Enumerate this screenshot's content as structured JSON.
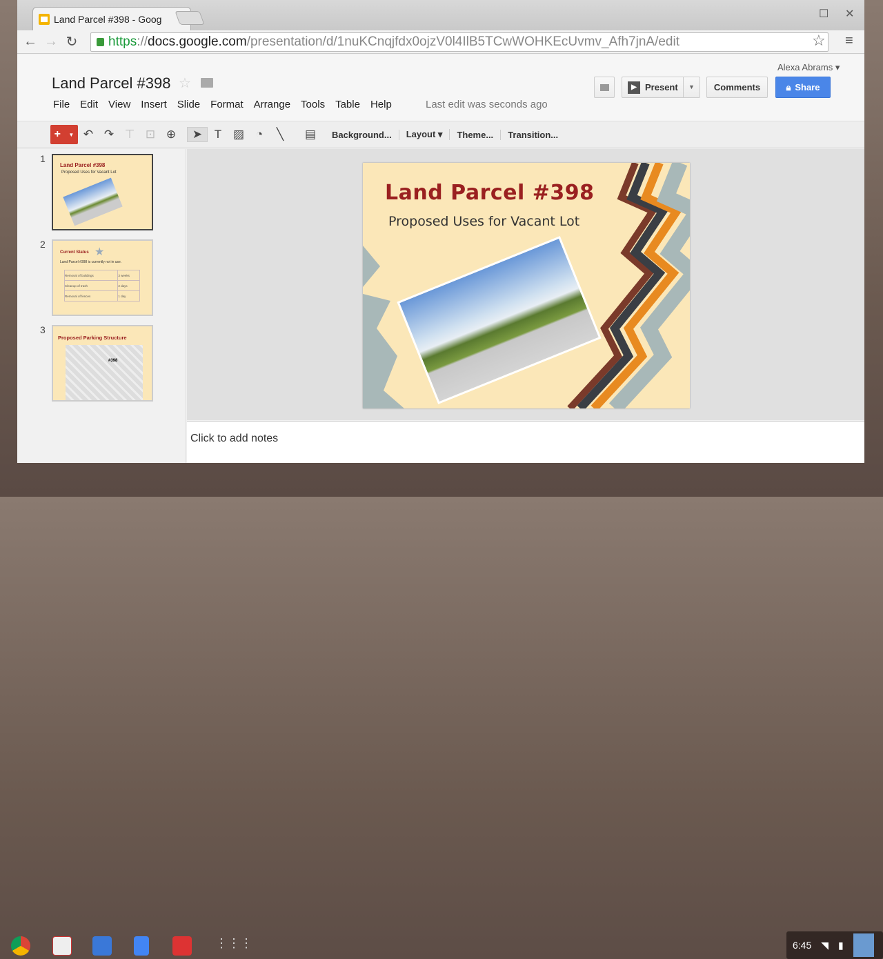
{
  "browser": {
    "tab_title": "Land Parcel #398 - Goog",
    "tab_close": "×",
    "url_scheme": "https",
    "url_host": "docs.google.com",
    "url_path": "/presentation/d/1nuKCnqjfdx0ojzV0l4IlB5TCwWOHKEcUvmv_Afh7jnA/edit"
  },
  "doc": {
    "title": "Land Parcel #398",
    "user": "Alexa Abrams ▾",
    "last_edit": "Last edit was seconds ago",
    "menu": [
      "File",
      "Edit",
      "View",
      "Insert",
      "Slide",
      "Format",
      "Arrange",
      "Tools",
      "Table",
      "Help"
    ],
    "present": "Present",
    "comments": "Comments",
    "share": "Share"
  },
  "toolbar": {
    "new": "+",
    "background": "Background...",
    "layout": "Layout ▾",
    "theme": "Theme...",
    "transition": "Transition..."
  },
  "slides": [
    {
      "num": "1",
      "title": "Land Parcel #398",
      "subtitle": "Proposed Uses for Vacant Lot"
    },
    {
      "num": "2",
      "title": "Current Status",
      "body": "Land Parcel #398 is currently not in use.",
      "rows": [
        [
          "Removal of buildings",
          "3 weeks"
        ],
        [
          "Cleanup of trash",
          "2 days"
        ],
        [
          "Removal of fences",
          "1 day"
        ]
      ]
    },
    {
      "num": "3",
      "title": "Proposed Parking Structure",
      "map_label": "#398"
    }
  ],
  "notes_placeholder": "Click to add notes",
  "tray": {
    "time": "6:45"
  },
  "colors": {
    "accent": "#4a86e8",
    "new_button": "#d23f31",
    "slide_title": "#9a2020",
    "slide_bg": "#fbe7b8"
  }
}
